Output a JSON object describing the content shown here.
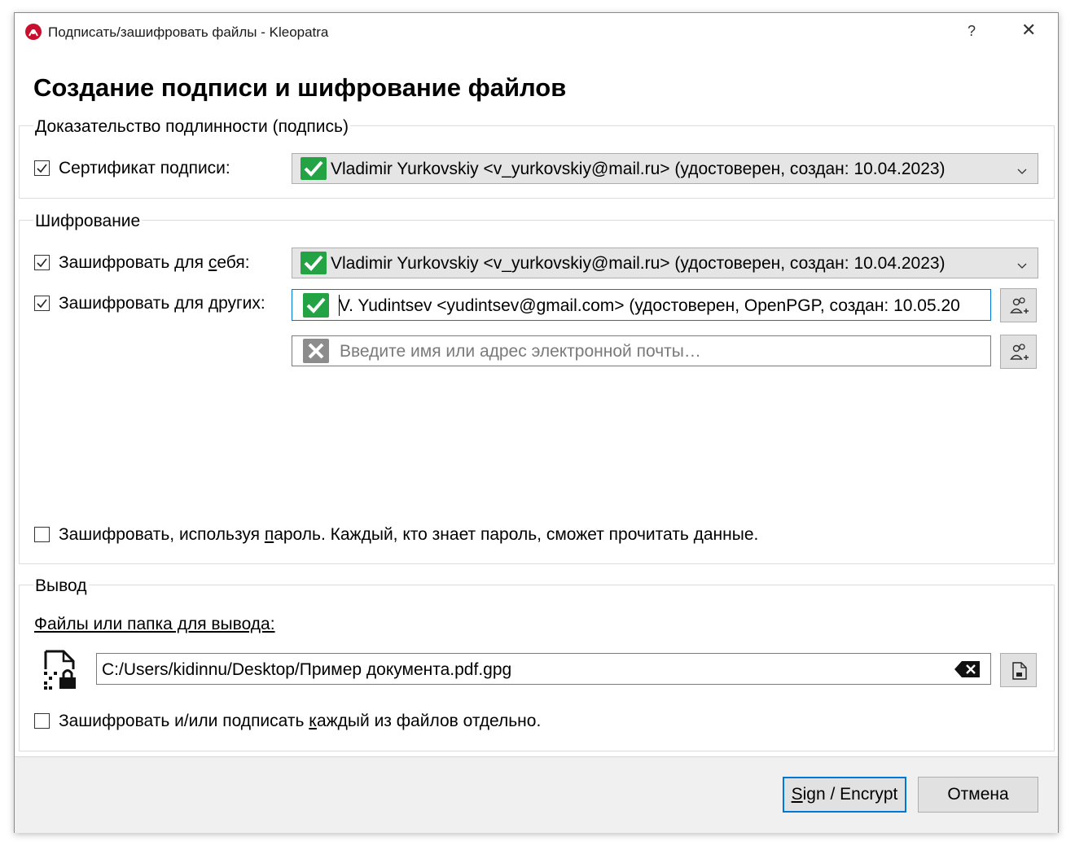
{
  "window": {
    "title": "Подписать/зашифровать файлы - Kleopatra",
    "help_label": "?",
    "close_label": "✕"
  },
  "heading": "Создание подписи и шифрование файлов",
  "signature": {
    "legend": "Доказательство подлинности (подпись)",
    "cert_label": "Сертификат подписи:",
    "cert_checked": true,
    "cert_value": "Vladimir Yurkovskiy <v_yurkovskiy@mail.ru> (удостоверен, создан: 10.04.2023)"
  },
  "encryption": {
    "legend": "Шифрование",
    "self_label_pre": "Зашифровать для ",
    "self_label_u": "с",
    "self_label_post": "ебя:",
    "self_checked": true,
    "self_value": "Vladimir Yurkovskiy <v_yurkovskiy@mail.ru> (удостоверен, создан: 10.04.2023)",
    "others_label": "Зашифровать для других:",
    "others_checked": true,
    "recipient_value": "V. Yudintsev <yudintsev@gmail.com> (удостоверен, OpenPGP, создан: 10.05.20",
    "recipient_placeholder": "Введите имя или адрес электронной почты…",
    "password_pre": "Зашифровать, используя ",
    "password_u": "п",
    "password_post": "ароль. Каждый, кто знает пароль, сможет прочитать данные.",
    "password_checked": false
  },
  "output": {
    "legend": "Вывод",
    "files_label": "Файлы или папка для вывода:",
    "path_value": "C:/Users/kidinnu/Desktop/Пример документа.pdf.gpg",
    "separately_pre": "Зашифровать и/или подписать ",
    "separately_u": "к",
    "separately_post": "аждый из файлов отдельно.",
    "separately_checked": false
  },
  "buttons": {
    "sign_encrypt_u": "S",
    "sign_encrypt_rest": "ign / Encrypt",
    "cancel": "Отмена"
  },
  "colors": {
    "ok_green": "#23a344",
    "focus_blue": "#0078d7",
    "app_icon_red": "#c8102e"
  },
  "icons": [
    "kleopatra-app-icon",
    "help-icon",
    "close-icon",
    "check-icon",
    "valid-cert-icon",
    "invalid-cert-icon",
    "chevron-down-icon",
    "add-recipient-icon",
    "file-lock-icon",
    "clear-icon",
    "browse-file-icon"
  ]
}
